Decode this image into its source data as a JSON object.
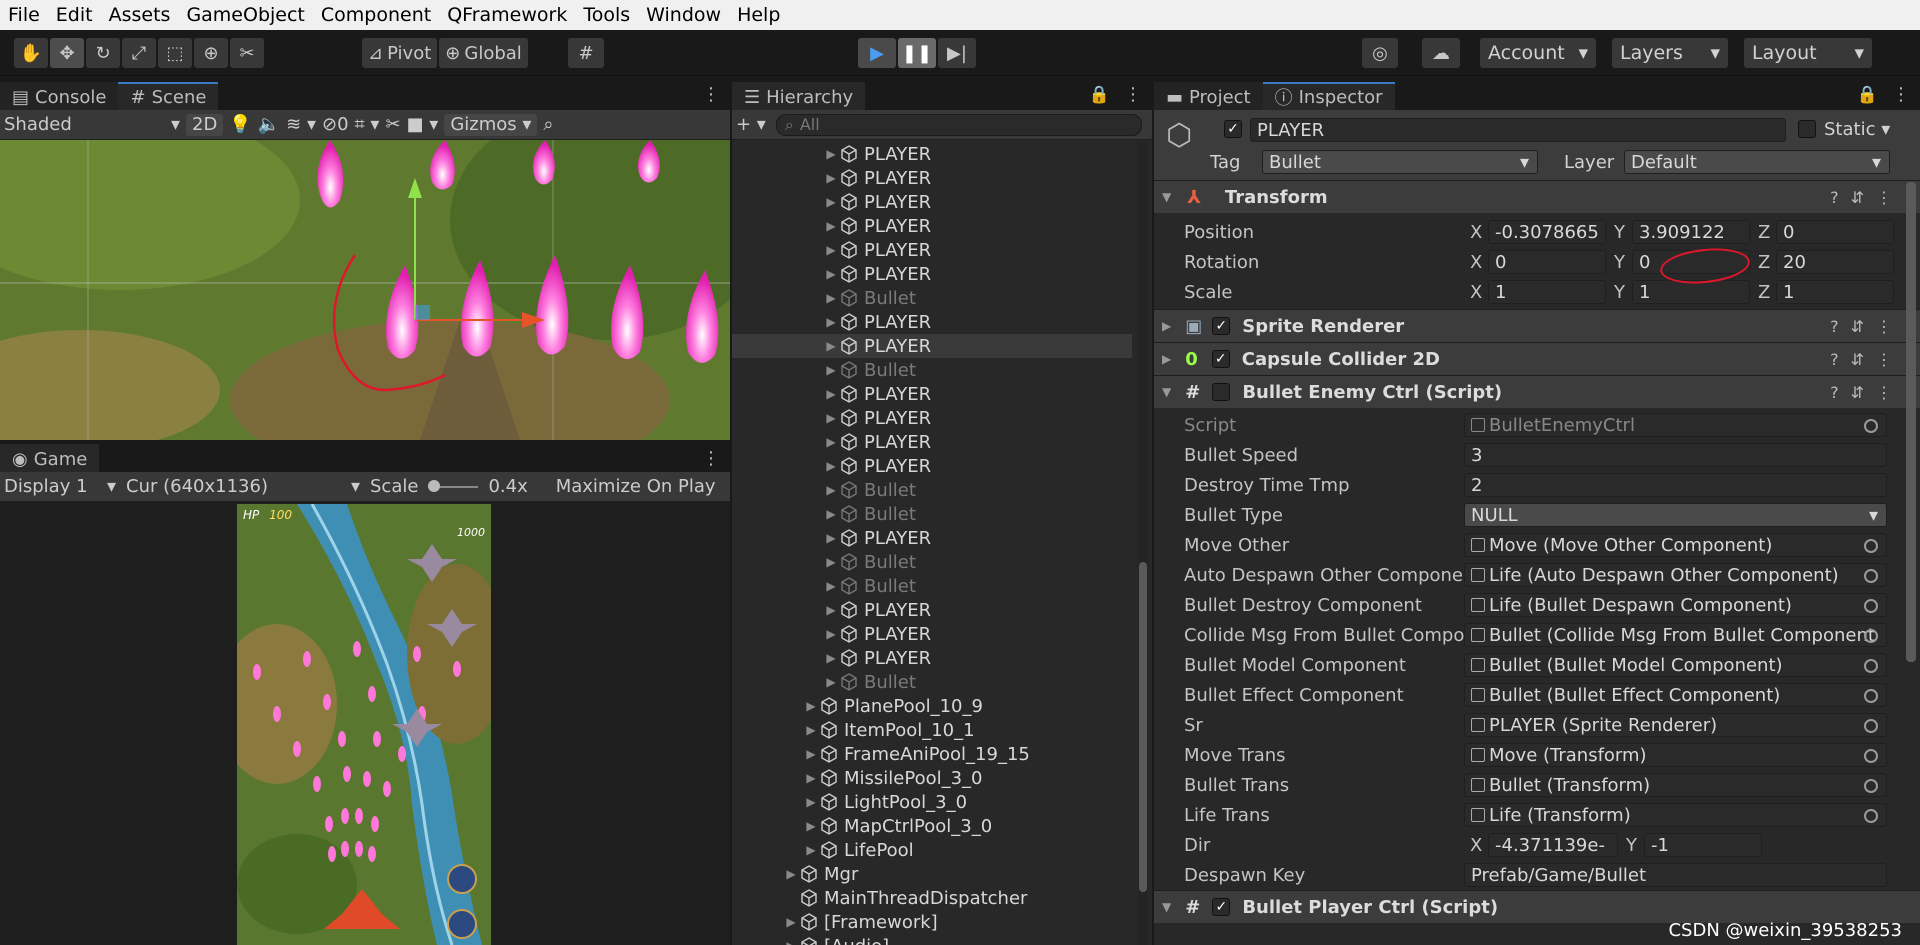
{
  "menu": [
    "File",
    "Edit",
    "Assets",
    "GameObject",
    "Component",
    "QFramework",
    "Tools",
    "Window",
    "Help"
  ],
  "toolbar": {
    "pivot": "Pivot",
    "global": "Global",
    "account": "Account",
    "layers": "Layers",
    "layout": "Layout"
  },
  "scene_panel": {
    "tabs": [
      "Console",
      "Scene"
    ],
    "shading": "Shaded",
    "mode2d": "2D",
    "hidden_count": "0",
    "gizmos": "Gizmos"
  },
  "game_panel": {
    "tab": "Game",
    "display": "Display 1",
    "resolution": "Cur (640x1136)",
    "scale_label": "Scale",
    "scale_value": "0.4x",
    "maximize": "Maximize On Play",
    "hp_label": "HP",
    "hp_value": "100",
    "score": "1000"
  },
  "hierarchy": {
    "tab": "Hierarchy",
    "search_placeholder": "All",
    "items": [
      {
        "label": "PLAYER",
        "indent": 3,
        "dim": false,
        "sel": false
      },
      {
        "label": "PLAYER",
        "indent": 3,
        "dim": false,
        "sel": false
      },
      {
        "label": "PLAYER",
        "indent": 3,
        "dim": false,
        "sel": false
      },
      {
        "label": "PLAYER",
        "indent": 3,
        "dim": false,
        "sel": false
      },
      {
        "label": "PLAYER",
        "indent": 3,
        "dim": false,
        "sel": false
      },
      {
        "label": "PLAYER",
        "indent": 3,
        "dim": false,
        "sel": false
      },
      {
        "label": "Bullet",
        "indent": 3,
        "dim": true,
        "sel": false
      },
      {
        "label": "PLAYER",
        "indent": 3,
        "dim": false,
        "sel": false
      },
      {
        "label": "PLAYER",
        "indent": 3,
        "dim": false,
        "sel": true
      },
      {
        "label": "Bullet",
        "indent": 3,
        "dim": true,
        "sel": false
      },
      {
        "label": "PLAYER",
        "indent": 3,
        "dim": false,
        "sel": false
      },
      {
        "label": "PLAYER",
        "indent": 3,
        "dim": false,
        "sel": false
      },
      {
        "label": "PLAYER",
        "indent": 3,
        "dim": false,
        "sel": false
      },
      {
        "label": "PLAYER",
        "indent": 3,
        "dim": false,
        "sel": false
      },
      {
        "label": "Bullet",
        "indent": 3,
        "dim": true,
        "sel": false
      },
      {
        "label": "Bullet",
        "indent": 3,
        "dim": true,
        "sel": false
      },
      {
        "label": "PLAYER",
        "indent": 3,
        "dim": false,
        "sel": false
      },
      {
        "label": "Bullet",
        "indent": 3,
        "dim": true,
        "sel": false
      },
      {
        "label": "Bullet",
        "indent": 3,
        "dim": true,
        "sel": false
      },
      {
        "label": "PLAYER",
        "indent": 3,
        "dim": false,
        "sel": false
      },
      {
        "label": "PLAYER",
        "indent": 3,
        "dim": false,
        "sel": false
      },
      {
        "label": "PLAYER",
        "indent": 3,
        "dim": false,
        "sel": false
      },
      {
        "label": "Bullet",
        "indent": 3,
        "dim": true,
        "sel": false
      },
      {
        "label": "PlanePool_10_9",
        "indent": 2,
        "dim": false,
        "sel": false
      },
      {
        "label": "ItemPool_10_1",
        "indent": 2,
        "dim": false,
        "sel": false
      },
      {
        "label": "FrameAniPool_19_15",
        "indent": 2,
        "dim": false,
        "sel": false
      },
      {
        "label": "MissilePool_3_0",
        "indent": 2,
        "dim": false,
        "sel": false
      },
      {
        "label": "LightPool_3_0",
        "indent": 2,
        "dim": false,
        "sel": false
      },
      {
        "label": "MapCtrlPool_3_0",
        "indent": 2,
        "dim": false,
        "sel": false
      },
      {
        "label": "LifePool",
        "indent": 2,
        "dim": false,
        "sel": false
      },
      {
        "label": "Mgr",
        "indent": 1,
        "dim": false,
        "sel": false
      },
      {
        "label": "MainThreadDispatcher",
        "indent": 1,
        "dim": false,
        "sel": false,
        "noarrow": true
      },
      {
        "label": "[Framework]",
        "indent": 1,
        "dim": false,
        "sel": false
      },
      {
        "label": "[Audio]",
        "indent": 1,
        "dim": false,
        "sel": false
      }
    ]
  },
  "inspector": {
    "tabs": [
      "Project",
      "Inspector"
    ],
    "object_name": "PLAYER",
    "static_label": "Static",
    "tag_label": "Tag",
    "tag_value": "Bullet",
    "layer_label": "Layer",
    "layer_value": "Default",
    "transform": {
      "title": "Transform",
      "rows": [
        {
          "label": "Position",
          "x": "-0.3078665",
          "y": "3.909122",
          "z": "0"
        },
        {
          "label": "Rotation",
          "x": "0",
          "y": "0",
          "z": "20"
        },
        {
          "label": "Scale",
          "x": "1",
          "y": "1",
          "z": "1"
        }
      ]
    },
    "components": [
      "Sprite Renderer",
      "Capsule Collider 2D"
    ],
    "script_component": {
      "title": "Bullet Enemy Ctrl (Script)",
      "fields": [
        {
          "label": "Script",
          "value": "BulletEnemyCtrl",
          "kind": "script"
        },
        {
          "label": "Bullet Speed",
          "value": "3",
          "kind": "text"
        },
        {
          "label": "Destroy Time Tmp",
          "value": "2",
          "kind": "text"
        },
        {
          "label": "Bullet Type",
          "value": "NULL",
          "kind": "enum"
        },
        {
          "label": "Move Other",
          "value": "Move (Move Other Component)",
          "kind": "obj"
        },
        {
          "label": "Auto Despawn Other Componen",
          "value": "Life (Auto Despawn Other Component)",
          "kind": "obj"
        },
        {
          "label": "Bullet Destroy Component",
          "value": "Life (Bullet Despawn Component)",
          "kind": "obj"
        },
        {
          "label": "Collide Msg From Bullet Compon",
          "value": "Bullet (Collide Msg From Bullet Component",
          "kind": "obj"
        },
        {
          "label": "Bullet Model Component",
          "value": "Bullet (Bullet Model Component)",
          "kind": "obj"
        },
        {
          "label": "Bullet Effect Component",
          "value": "Bullet (Bullet Effect Component)",
          "kind": "obj"
        },
        {
          "label": "Sr",
          "value": "PLAYER (Sprite Renderer)",
          "kind": "obj"
        },
        {
          "label": "Move Trans",
          "value": "Move (Transform)",
          "kind": "obj"
        },
        {
          "label": "Bullet Trans",
          "value": "Bullet (Transform)",
          "kind": "obj"
        },
        {
          "label": "Life Trans",
          "value": "Life (Transform)",
          "kind": "obj"
        }
      ],
      "dir_label": "Dir",
      "dir_x": "-4.371139e-",
      "dir_y": "-1",
      "despawn_label": "Despawn Key",
      "despawn_value": "Prefab/Game/Bullet"
    },
    "next_component": "Bullet Player Ctrl (Script)"
  },
  "watermark": "CSDN @weixin_39538253",
  "colors": {
    "accent": "#3a78c8",
    "annotation": "#e0162b"
  }
}
